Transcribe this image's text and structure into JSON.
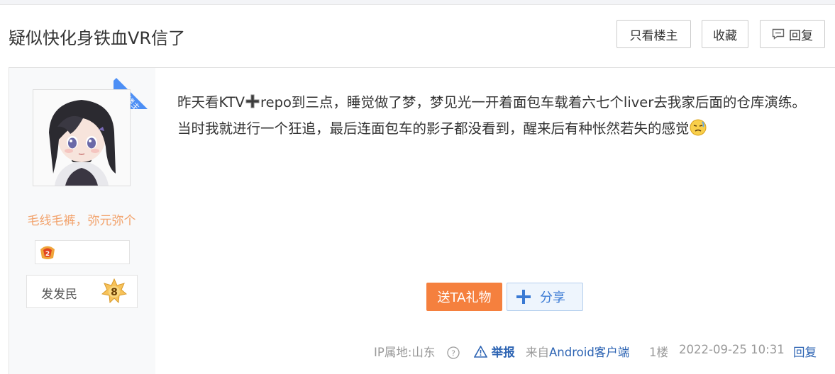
{
  "post": {
    "title": "疑似快化身铁血VR信了",
    "actions": {
      "only_op": "只看楼主",
      "favorite": "收藏",
      "reply": "回复"
    }
  },
  "author": {
    "ribbon": "楼主",
    "name": "毛线毛裤，弥元弥个",
    "level_title": "发发民",
    "level": "8"
  },
  "body": {
    "text_a": "昨天看KTV",
    "text_b": "repo到三点，睡觉做了梦，梦见光一开着面包车载着六七个liver去我家后面的仓库演练。当时我就进行一个狂追，最后连面包车的影子都没看到，醒来后有种怅然若失的感觉"
  },
  "buttons": {
    "gift": "送TA礼物",
    "share": "分享"
  },
  "meta": {
    "ip": "IP属地:山东",
    "report": "举报",
    "from_prefix": "来自",
    "client": "Android客户端",
    "floor": "1楼",
    "time": "2022-09-25 10:31",
    "reply": "回复"
  },
  "colors": {
    "accent_blue": "#2d64b3",
    "ribbon_blue": "#4d8ff5",
    "gift_orange": "#f5803e",
    "username_orange": "#f2a26b"
  }
}
